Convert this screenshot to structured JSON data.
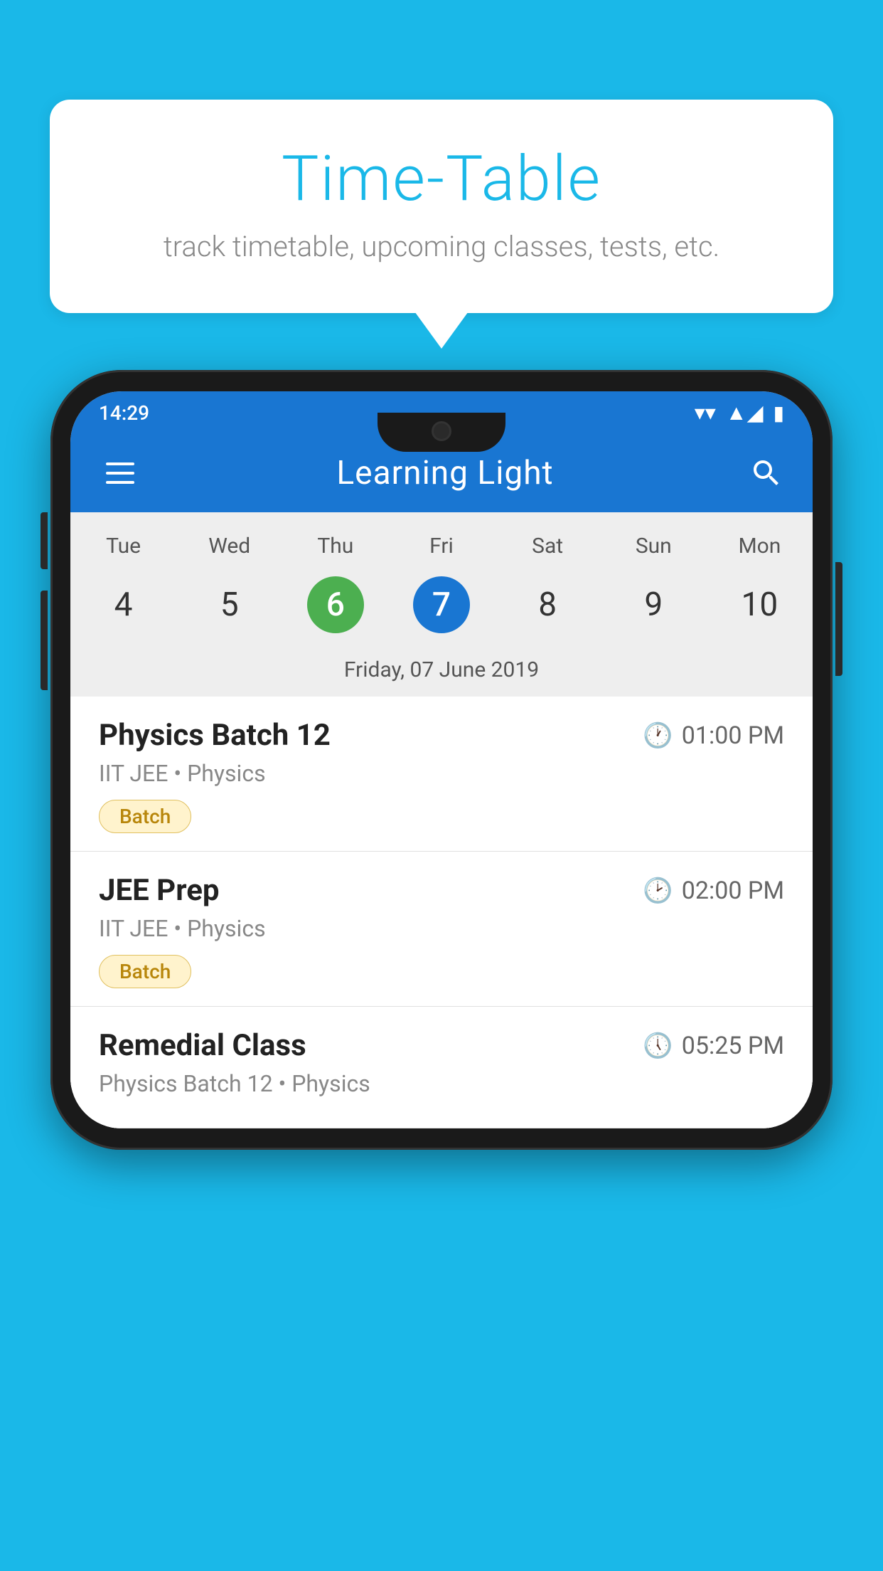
{
  "background_color": "#1ab8e8",
  "speech_bubble": {
    "title": "Time-Table",
    "subtitle": "track timetable, upcoming classes, tests, etc."
  },
  "phone": {
    "status_bar": {
      "time": "14:29"
    },
    "app_bar": {
      "title": "Learning Light"
    },
    "calendar": {
      "days": [
        "Tue",
        "Wed",
        "Thu",
        "Fri",
        "Sat",
        "Sun",
        "Mon"
      ],
      "dates": [
        {
          "num": "4",
          "state": "normal"
        },
        {
          "num": "5",
          "state": "normal"
        },
        {
          "num": "6",
          "state": "today"
        },
        {
          "num": "7",
          "state": "selected"
        },
        {
          "num": "8",
          "state": "normal"
        },
        {
          "num": "9",
          "state": "normal"
        },
        {
          "num": "10",
          "state": "normal"
        }
      ],
      "selected_date_label": "Friday, 07 June 2019"
    },
    "schedule": {
      "items": [
        {
          "name": "Physics Batch 12",
          "time": "01:00 PM",
          "sub": "IIT JEE • Physics",
          "tag": "Batch"
        },
        {
          "name": "JEE Prep",
          "time": "02:00 PM",
          "sub": "IIT JEE • Physics",
          "tag": "Batch"
        },
        {
          "name": "Remedial Class",
          "time": "05:25 PM",
          "sub": "Physics Batch 12 • Physics",
          "tag": null
        }
      ]
    }
  }
}
